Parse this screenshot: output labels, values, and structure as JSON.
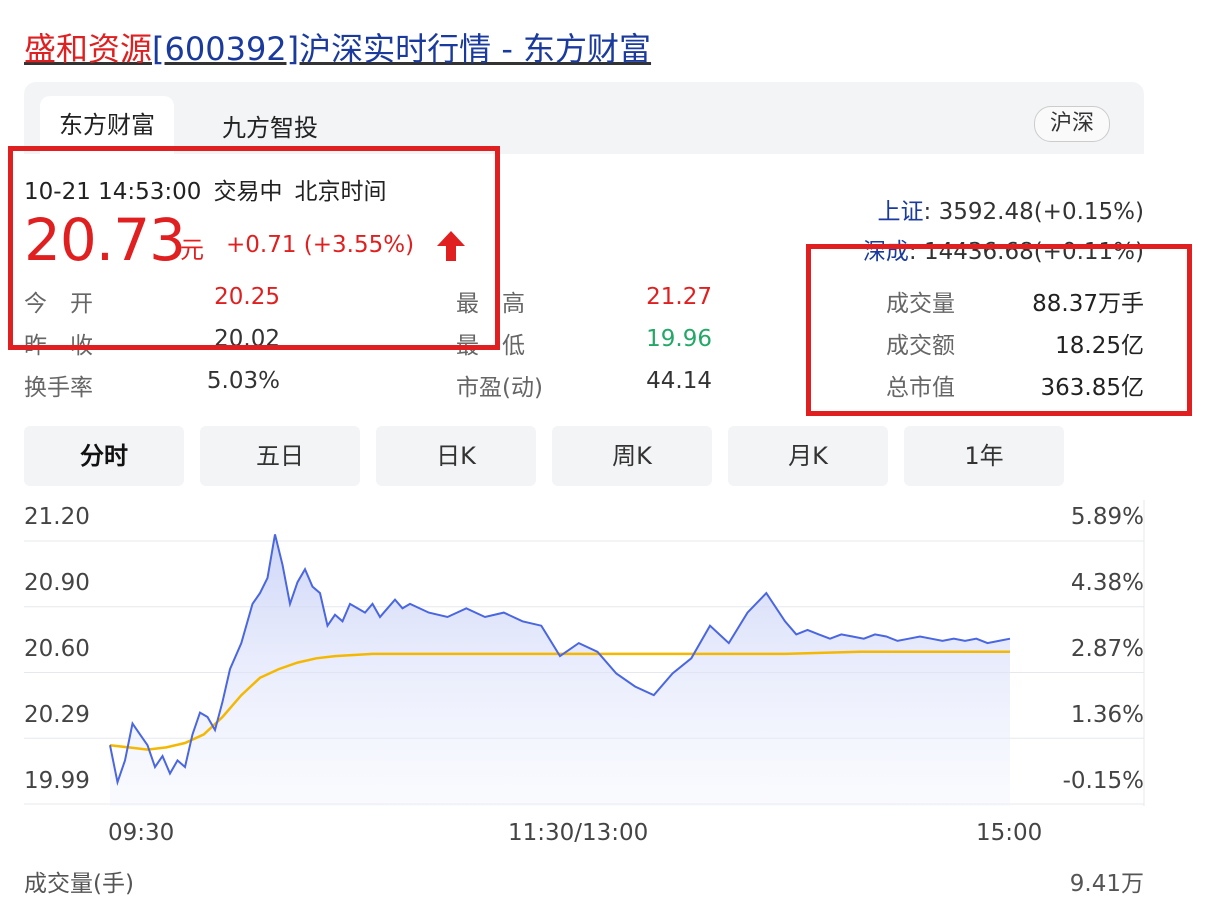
{
  "page": {
    "title_stock": "盛和资源",
    "title_rest": "[600392]沪深实时行情 - 东方财富"
  },
  "tabs": [
    "东方财富",
    "九方智投"
  ],
  "market_badge": "沪深",
  "quote": {
    "datetime": "10-21 14:53:00",
    "status": "交易中",
    "timezone": "北京时间",
    "price": "20.73",
    "unit": "元",
    "change": "+0.71 (+3.55%)",
    "direction": "up"
  },
  "stats": {
    "open_label": "今　开",
    "open": "20.25",
    "prev_close_label": "昨　收",
    "prev_close": "20.02",
    "turnover_label": "换手率",
    "turnover": "5.03%",
    "high_label": "最　高",
    "high": "21.27",
    "low_label": "最　低",
    "low": "19.96",
    "pe_label": "市盈(动)",
    "pe": "44.14",
    "volume_label": "成交量",
    "volume": "88.37万手",
    "amount_label": "成交额",
    "amount": "18.25亿",
    "mktcap_label": "总市值",
    "mktcap": "363.85亿"
  },
  "indices": [
    {
      "name": "上证",
      "value": "3592.48(+0.15%)"
    },
    {
      "name": "深成",
      "value": "14436.68(+0.11%)"
    }
  ],
  "periods": [
    "分时",
    "五日",
    "日K",
    "周K",
    "月K",
    "1年"
  ],
  "active_period": "分时",
  "colors": {
    "up": "#e02020",
    "down": "#23a867",
    "price_line": "#4a66e0",
    "avg_line": "#f5b800",
    "brand_blue": "#1a3a9e"
  },
  "bottom_labels": {
    "left": "成交量(手)",
    "right": "9.41万"
  },
  "chart_data": {
    "type": "line",
    "y_left_ticks": [
      "21.20",
      "20.90",
      "20.60",
      "20.29",
      "19.99"
    ],
    "y_right_ticks": [
      "5.89%",
      "4.38%",
      "2.87%",
      "1.36%",
      "-0.15%"
    ],
    "x_ticks": [
      "09:30",
      "11:30/13:00",
      "15:00"
    ],
    "ylim": [
      19.99,
      21.2
    ],
    "xlim": [
      0,
      240
    ],
    "series": [
      {
        "x": [
          0,
          2,
          4,
          6,
          8,
          10,
          12,
          14,
          16,
          18,
          20,
          22,
          24,
          26,
          28,
          30,
          32,
          35,
          38,
          40,
          42,
          44,
          46,
          48,
          50,
          52,
          54,
          56,
          58,
          60,
          62,
          64,
          66,
          68,
          70,
          72,
          74,
          76,
          78,
          80,
          85,
          90,
          95,
          100,
          105,
          110,
          115,
          120,
          125,
          130,
          135,
          140,
          145,
          150,
          155,
          160,
          165,
          170,
          175,
          180,
          183,
          186,
          189,
          192,
          195,
          198,
          201,
          204,
          207,
          210,
          213,
          216,
          219,
          222,
          225,
          228,
          231,
          234,
          237,
          240
        ],
        "values": [
          20.15,
          19.98,
          20.08,
          20.25,
          20.2,
          20.15,
          20.05,
          20.1,
          20.02,
          20.08,
          20.05,
          20.2,
          20.3,
          20.28,
          20.22,
          20.35,
          20.5,
          20.62,
          20.8,
          20.85,
          20.92,
          21.12,
          20.98,
          20.8,
          20.9,
          20.96,
          20.88,
          20.85,
          20.7,
          20.75,
          20.72,
          20.8,
          20.78,
          20.76,
          20.8,
          20.74,
          20.78,
          20.82,
          20.78,
          20.8,
          20.76,
          20.74,
          20.78,
          20.74,
          20.76,
          20.72,
          20.7,
          20.56,
          20.62,
          20.58,
          20.48,
          20.42,
          20.38,
          20.48,
          20.55,
          20.7,
          20.62,
          20.76,
          20.85,
          20.72,
          20.66,
          20.68,
          20.66,
          20.64,
          20.66,
          20.65,
          20.64,
          20.66,
          20.65,
          20.63,
          20.64,
          20.65,
          20.64,
          20.63,
          20.64,
          20.63,
          20.64,
          20.62,
          20.63,
          20.64
        ]
      },
      {
        "x": [
          0,
          5,
          10,
          15,
          20,
          25,
          30,
          35,
          40,
          45,
          50,
          55,
          60,
          70,
          80,
          100,
          120,
          140,
          160,
          180,
          200,
          220,
          240
        ],
        "values": [
          20.15,
          20.14,
          20.13,
          20.14,
          20.16,
          20.2,
          20.28,
          20.38,
          20.46,
          20.5,
          20.53,
          20.55,
          20.56,
          20.57,
          20.57,
          20.57,
          20.57,
          20.57,
          20.57,
          20.57,
          20.58,
          20.58,
          20.58
        ]
      }
    ]
  }
}
